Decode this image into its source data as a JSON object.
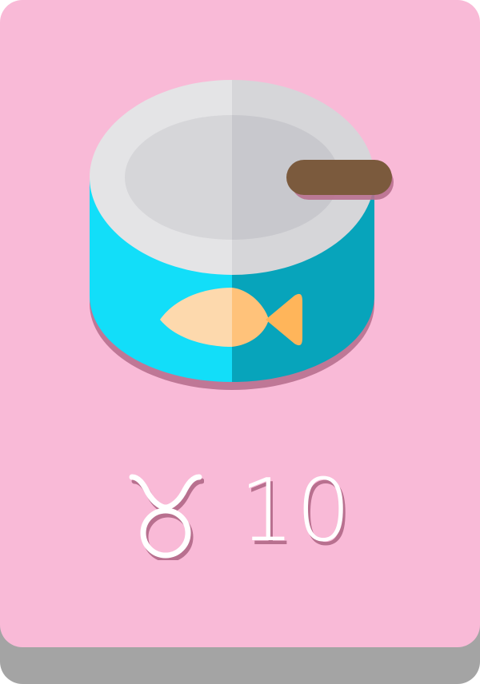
{
  "card": {
    "item_icon": "tuna-can-icon",
    "sign_icon": "taurus-icon",
    "value": "10"
  },
  "colors": {
    "card_background": "#f9bad7",
    "card_shadow": "#a4a4a4",
    "can_body_light": "#12def9",
    "can_body_dark": "#07a4bb",
    "lid_light": "#e4e4e6",
    "lid_dark": "#d6d6d9",
    "pull_tab": "#7b5a3d",
    "fish_light": "#fdd9ad",
    "fish_dark": "#ffb55a",
    "text": "#ffffff"
  }
}
